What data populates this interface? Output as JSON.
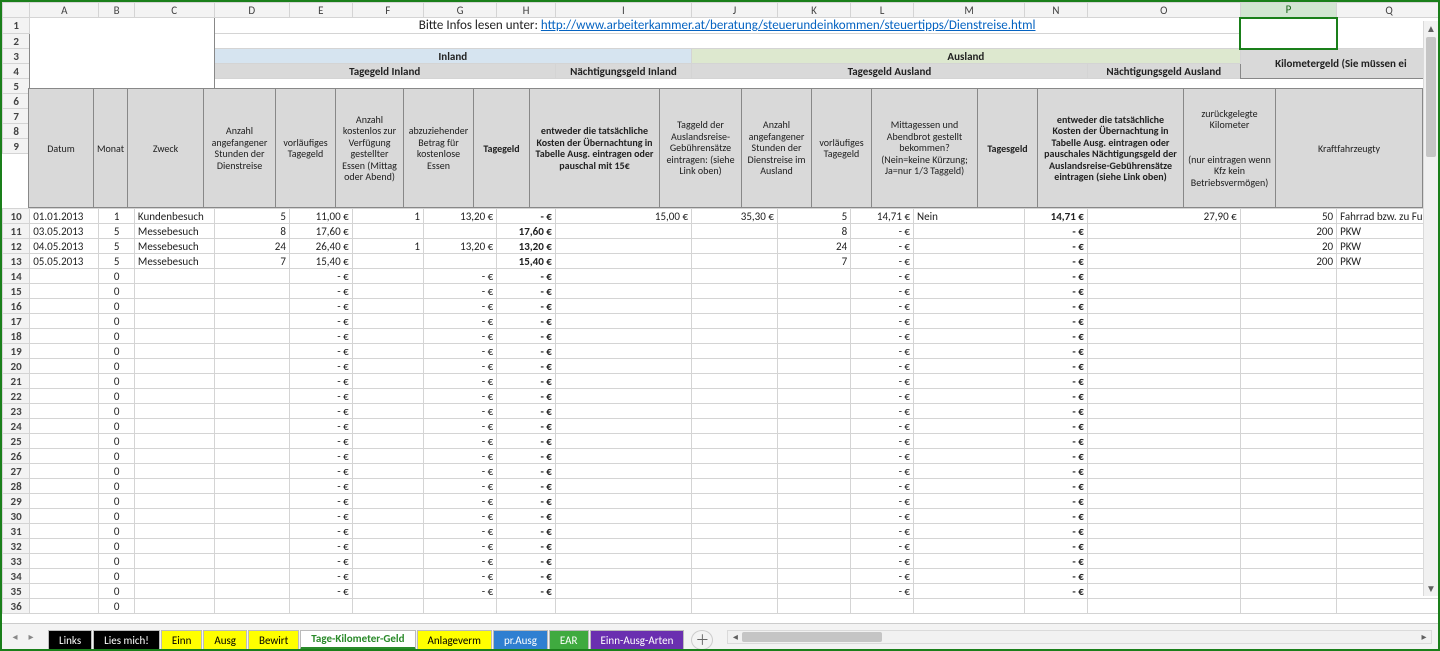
{
  "selected_cell": "P2",
  "columns": [
    "A",
    "B",
    "C",
    "D",
    "E",
    "F",
    "G",
    "H",
    "I",
    "J",
    "K",
    "L",
    "M",
    "N",
    "O",
    "P",
    "Q"
  ],
  "infoText": "Bitte Infos lesen unter: ",
  "infoLink": "http://www.arbeiterkammer.at/beratung/steuerundeinkommen/steuertipps/Dienstreise.html",
  "group": {
    "inland": "Inland",
    "ausland": "Ausland",
    "km": "Kilometergeld (Sie müssen ei"
  },
  "section": {
    "tg_inland": "Tagegeld Inland",
    "ng_inland": "Nächtigungsgeld Inland",
    "tg_ausland": "Tagesgeld Ausland",
    "ng_ausland": "Nächtigungsgeld Ausland"
  },
  "headers": {
    "A": "Datum",
    "B": "Monat",
    "C": "Zweck",
    "D": "Anzahl angefangener Stunden der Dienstreise",
    "E": "vorläufiges Tagegeld",
    "F": "Anzahl kostenlos zur Verfügung gestellter Essen (Mittag oder Abend)",
    "G": "abzuziehender Betrag für kostenlose Essen",
    "H": "Tagegeld",
    "I": "entweder die tatsächliche Kosten der Übernachtung in Tabelle Ausg. eintragen oder pauschal mit 15€",
    "J": "Taggeld der Auslandsreise-Gebührensätze eintragen: (siehe Link oben)",
    "K": "Anzahl angefangener Stunden der Dienstreise im Ausland",
    "L": "vorläufiges Tagegeld",
    "M": "Mittagessen und Abendbrot gestellt bekommen? (Nein=keine Kürzung; Ja=nur 1/3 Taggeld)",
    "N": "Tagesgeld",
    "O": "entweder die tatsächliche Kosten der Übernachtung in Tabelle Ausg. eintragen oder pauschales Nächtigungsgeld der Auslandsreise-Gebührensätze eintragen (siehe Link oben)",
    "P": "zurückgelegte Kilometer",
    "P2": "(nur eintragen wenn Kfz kein Betriebsvermögen)",
    "Q": "Kraftfahrzeugty"
  },
  "rows": [
    {
      "n": 10,
      "A": "01.01.2013",
      "B": "1",
      "C": "Kundenbesuch",
      "D": "5",
      "E": "11,00 €",
      "F": "1",
      "G": "13,20 €",
      "H": "-   €",
      "I": "15,00 €",
      "J": "35,30 €",
      "K": "5",
      "L": "14,71 €",
      "M": "Nein",
      "N": "14,71 €",
      "O": "27,90 €",
      "P": "50",
      "Q": "Fahrrad bzw. zu Fuß"
    },
    {
      "n": 11,
      "A": "03.05.2013",
      "B": "5",
      "C": "Messebesuch",
      "D": "8",
      "E": "17,60 €",
      "F": "",
      "G": "",
      "H": "17,60 €",
      "I": "",
      "J": "",
      "K": "8",
      "L": "-   €",
      "M": "",
      "N": "-   €",
      "O": "",
      "P": "200",
      "Q": "PKW"
    },
    {
      "n": 12,
      "A": "04.05.2013",
      "B": "5",
      "C": "Messebesuch",
      "D": "24",
      "E": "26,40 €",
      "F": "1",
      "G": "13,20 €",
      "H": "13,20 €",
      "I": "",
      "J": "",
      "K": "24",
      "L": "-   €",
      "M": "",
      "N": "-   €",
      "O": "",
      "P": "20",
      "Q": "PKW"
    },
    {
      "n": 13,
      "A": "05.05.2013",
      "B": "5",
      "C": "Messebesuch",
      "D": "7",
      "E": "15,40 €",
      "F": "",
      "G": "",
      "H": "15,40 €",
      "I": "",
      "J": "",
      "K": "7",
      "L": "-   €",
      "M": "",
      "N": "-   €",
      "O": "",
      "P": "200",
      "Q": "PKW"
    },
    {
      "n": 14,
      "A": "",
      "B": "0",
      "C": "",
      "D": "",
      "E": "-   €",
      "F": "",
      "G": "-   €",
      "H": "-   €",
      "I": "",
      "J": "",
      "K": "",
      "L": "-   €",
      "M": "",
      "N": "-   €",
      "O": "",
      "P": "",
      "Q": ""
    },
    {
      "n": 15,
      "A": "",
      "B": "0",
      "C": "",
      "D": "",
      "E": "-   €",
      "F": "",
      "G": "-   €",
      "H": "-   €",
      "I": "",
      "J": "",
      "K": "",
      "L": "-   €",
      "M": "",
      "N": "-   €",
      "O": "",
      "P": "",
      "Q": ""
    },
    {
      "n": 16,
      "A": "",
      "B": "0",
      "C": "",
      "D": "",
      "E": "-   €",
      "F": "",
      "G": "-   €",
      "H": "-   €",
      "I": "",
      "J": "",
      "K": "",
      "L": "-   €",
      "M": "",
      "N": "-   €",
      "O": "",
      "P": "",
      "Q": ""
    },
    {
      "n": 17,
      "A": "",
      "B": "0",
      "C": "",
      "D": "",
      "E": "-   €",
      "F": "",
      "G": "-   €",
      "H": "-   €",
      "I": "",
      "J": "",
      "K": "",
      "L": "-   €",
      "M": "",
      "N": "-   €",
      "O": "",
      "P": "",
      "Q": ""
    },
    {
      "n": 18,
      "A": "",
      "B": "0",
      "C": "",
      "D": "",
      "E": "-   €",
      "F": "",
      "G": "-   €",
      "H": "-   €",
      "I": "",
      "J": "",
      "K": "",
      "L": "-   €",
      "M": "",
      "N": "-   €",
      "O": "",
      "P": "",
      "Q": ""
    },
    {
      "n": 19,
      "A": "",
      "B": "0",
      "C": "",
      "D": "",
      "E": "-   €",
      "F": "",
      "G": "-   €",
      "H": "-   €",
      "I": "",
      "J": "",
      "K": "",
      "L": "-   €",
      "M": "",
      "N": "-   €",
      "O": "",
      "P": "",
      "Q": ""
    },
    {
      "n": 20,
      "A": "",
      "B": "0",
      "C": "",
      "D": "",
      "E": "-   €",
      "F": "",
      "G": "-   €",
      "H": "-   €",
      "I": "",
      "J": "",
      "K": "",
      "L": "-   €",
      "M": "",
      "N": "-   €",
      "O": "",
      "P": "",
      "Q": ""
    },
    {
      "n": 21,
      "A": "",
      "B": "0",
      "C": "",
      "D": "",
      "E": "-   €",
      "F": "",
      "G": "-   €",
      "H": "-   €",
      "I": "",
      "J": "",
      "K": "",
      "L": "-   €",
      "M": "",
      "N": "-   €",
      "O": "",
      "P": "",
      "Q": ""
    },
    {
      "n": 22,
      "A": "",
      "B": "0",
      "C": "",
      "D": "",
      "E": "-   €",
      "F": "",
      "G": "-   €",
      "H": "-   €",
      "I": "",
      "J": "",
      "K": "",
      "L": "-   €",
      "M": "",
      "N": "-   €",
      "O": "",
      "P": "",
      "Q": ""
    },
    {
      "n": 23,
      "A": "",
      "B": "0",
      "C": "",
      "D": "",
      "E": "-   €",
      "F": "",
      "G": "-   €",
      "H": "-   €",
      "I": "",
      "J": "",
      "K": "",
      "L": "-   €",
      "M": "",
      "N": "-   €",
      "O": "",
      "P": "",
      "Q": ""
    },
    {
      "n": 24,
      "A": "",
      "B": "0",
      "C": "",
      "D": "",
      "E": "-   €",
      "F": "",
      "G": "-   €",
      "H": "-   €",
      "I": "",
      "J": "",
      "K": "",
      "L": "-   €",
      "M": "",
      "N": "-   €",
      "O": "",
      "P": "",
      "Q": ""
    },
    {
      "n": 25,
      "A": "",
      "B": "0",
      "C": "",
      "D": "",
      "E": "-   €",
      "F": "",
      "G": "-   €",
      "H": "-   €",
      "I": "",
      "J": "",
      "K": "",
      "L": "-   €",
      "M": "",
      "N": "-   €",
      "O": "",
      "P": "",
      "Q": ""
    },
    {
      "n": 26,
      "A": "",
      "B": "0",
      "C": "",
      "D": "",
      "E": "-   €",
      "F": "",
      "G": "-   €",
      "H": "-   €",
      "I": "",
      "J": "",
      "K": "",
      "L": "-   €",
      "M": "",
      "N": "-   €",
      "O": "",
      "P": "",
      "Q": ""
    },
    {
      "n": 27,
      "A": "",
      "B": "0",
      "C": "",
      "D": "",
      "E": "-   €",
      "F": "",
      "G": "-   €",
      "H": "-   €",
      "I": "",
      "J": "",
      "K": "",
      "L": "-   €",
      "M": "",
      "N": "-   €",
      "O": "",
      "P": "",
      "Q": ""
    },
    {
      "n": 28,
      "A": "",
      "B": "0",
      "C": "",
      "D": "",
      "E": "-   €",
      "F": "",
      "G": "-   €",
      "H": "-   €",
      "I": "",
      "J": "",
      "K": "",
      "L": "-   €",
      "M": "",
      "N": "-   €",
      "O": "",
      "P": "",
      "Q": ""
    },
    {
      "n": 29,
      "A": "",
      "B": "0",
      "C": "",
      "D": "",
      "E": "-   €",
      "F": "",
      "G": "-   €",
      "H": "-   €",
      "I": "",
      "J": "",
      "K": "",
      "L": "-   €",
      "M": "",
      "N": "-   €",
      "O": "",
      "P": "",
      "Q": ""
    },
    {
      "n": 30,
      "A": "",
      "B": "0",
      "C": "",
      "D": "",
      "E": "-   €",
      "F": "",
      "G": "-   €",
      "H": "-   €",
      "I": "",
      "J": "",
      "K": "",
      "L": "-   €",
      "M": "",
      "N": "-   €",
      "O": "",
      "P": "",
      "Q": ""
    },
    {
      "n": 31,
      "A": "",
      "B": "0",
      "C": "",
      "D": "",
      "E": "-   €",
      "F": "",
      "G": "-   €",
      "H": "-   €",
      "I": "",
      "J": "",
      "K": "",
      "L": "-   €",
      "M": "",
      "N": "-   €",
      "O": "",
      "P": "",
      "Q": ""
    },
    {
      "n": 32,
      "A": "",
      "B": "0",
      "C": "",
      "D": "",
      "E": "-   €",
      "F": "",
      "G": "-   €",
      "H": "-   €",
      "I": "",
      "J": "",
      "K": "",
      "L": "-   €",
      "M": "",
      "N": "-   €",
      "O": "",
      "P": "",
      "Q": ""
    },
    {
      "n": 33,
      "A": "",
      "B": "0",
      "C": "",
      "D": "",
      "E": "-   €",
      "F": "",
      "G": "-   €",
      "H": "-   €",
      "I": "",
      "J": "",
      "K": "",
      "L": "-   €",
      "M": "",
      "N": "-   €",
      "O": "",
      "P": "",
      "Q": ""
    },
    {
      "n": 34,
      "A": "",
      "B": "0",
      "C": "",
      "D": "",
      "E": "-   €",
      "F": "",
      "G": "-   €",
      "H": "-   €",
      "I": "",
      "J": "",
      "K": "",
      "L": "-   €",
      "M": "",
      "N": "-   €",
      "O": "",
      "P": "",
      "Q": ""
    },
    {
      "n": 35,
      "A": "",
      "B": "0",
      "C": "",
      "D": "",
      "E": "-   €",
      "F": "",
      "G": "-   €",
      "H": "-   €",
      "I": "",
      "J": "",
      "K": "",
      "L": "-   €",
      "M": "",
      "N": "-   €",
      "O": "",
      "P": "",
      "Q": ""
    },
    {
      "n": 36,
      "A": "",
      "B": "0",
      "C": "",
      "D": "",
      "E": "",
      "F": "",
      "G": "",
      "H": "",
      "I": "",
      "J": "",
      "K": "",
      "L": "",
      "M": "",
      "N": "",
      "O": "",
      "P": "",
      "Q": ""
    }
  ],
  "tabs": [
    {
      "label": "Links",
      "bg": "#000",
      "fg": "#fff"
    },
    {
      "label": "Lies mich!",
      "bg": "#000",
      "fg": "#fff"
    },
    {
      "label": "Einn",
      "bg": "#ffff00",
      "fg": "#000"
    },
    {
      "label": "Ausg",
      "bg": "#ffff00",
      "fg": "#000"
    },
    {
      "label": "Bewirt",
      "bg": "#ffff00",
      "fg": "#000"
    },
    {
      "label": "Tage-Kilometer-Geld",
      "bg": "#fff",
      "fg": "#2a8a2a",
      "active": true
    },
    {
      "label": "Anlageverm",
      "bg": "#ffff00",
      "fg": "#000"
    },
    {
      "label": "pr.Ausg",
      "bg": "#2f7fd1",
      "fg": "#fff"
    },
    {
      "label": "EAR",
      "bg": "#3faa3f",
      "fg": "#fff"
    },
    {
      "label": "Einn-Ausg-Arten",
      "bg": "#6a2fb0",
      "fg": "#fff"
    }
  ]
}
